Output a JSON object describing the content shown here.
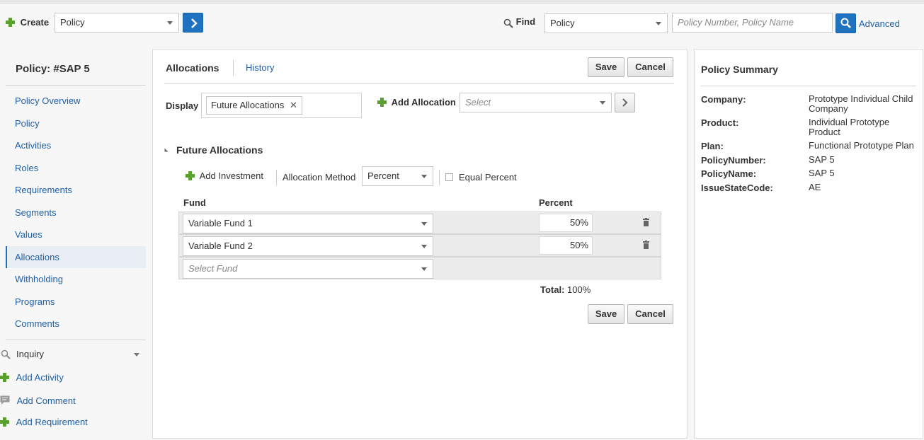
{
  "header": {
    "create_label": "Create",
    "create_select": "Policy",
    "find_label": "Find",
    "find_select": "Policy",
    "search_placeholder": "Policy Number, Policy Name",
    "advanced_label": "Advanced"
  },
  "sidebar": {
    "title": "Policy: #SAP 5",
    "items": [
      "Policy Overview",
      "Policy",
      "Activities",
      "Roles",
      "Requirements",
      "Segments",
      "Values",
      "Allocations",
      "Withholding",
      "Programs",
      "Comments"
    ],
    "active": "Allocations",
    "inquiry_label": "Inquiry",
    "actions": [
      "Add Activity",
      "Add Comment",
      "Add Requirement"
    ]
  },
  "main": {
    "tabs": [
      "Allocations",
      "History"
    ],
    "save_label": "Save",
    "cancel_label": "Cancel",
    "display_label": "Display",
    "display_token": "Future Allocations",
    "add_allocation_label": "Add Allocation",
    "add_allocation_placeholder": "Select",
    "section_title": "Future Allocations",
    "add_investment_label": "Add Investment",
    "allocation_method_label": "Allocation Method",
    "allocation_method_value": "Percent",
    "equal_percent_label": "Equal Percent",
    "fund_header": "Fund",
    "percent_header": "Percent",
    "rows": [
      {
        "fund": "Variable Fund 1",
        "percent": "50%"
      },
      {
        "fund": "Variable Fund 2",
        "percent": "50%"
      }
    ],
    "select_fund_placeholder": "Select Fund",
    "total_label": "Total:",
    "total_value": "100%"
  },
  "summary": {
    "title": "Policy Summary",
    "fields": [
      {
        "k": "Company:",
        "v": "Prototype Individual Child Company"
      },
      {
        "k": "Product:",
        "v": "Individual Prototype Product"
      },
      {
        "k": "Plan:",
        "v": "Functional Prototype Plan"
      },
      {
        "k": "PolicyNumber:",
        "v": "SAP 5"
      },
      {
        "k": "PolicyName:",
        "v": "SAP 5"
      },
      {
        "k": "IssueStateCode:",
        "v": "AE"
      }
    ]
  },
  "colors": {
    "accent": "#1f72c0",
    "link": "#1f5fa6",
    "add_green": "#5aa02c"
  }
}
